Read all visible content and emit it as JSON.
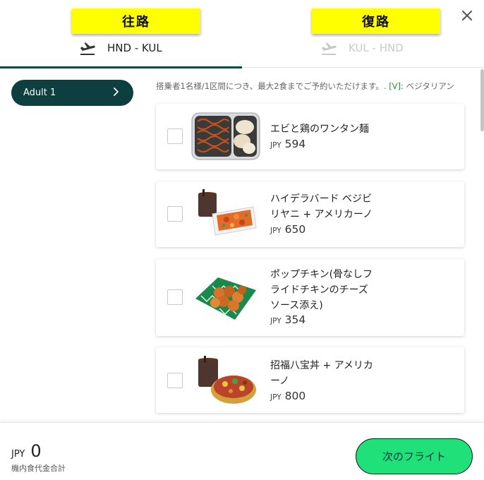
{
  "header": {
    "outbound_tab": {
      "highlight": "往路",
      "route": "HND - KUL"
    },
    "return_tab": {
      "highlight": "復路",
      "route": "KUL - HND"
    },
    "close_icon": "close-icon",
    "active_color": "#0c4a47"
  },
  "sidebar": {
    "passenger": "Adult 1",
    "icon": "chevron-right-icon"
  },
  "main": {
    "note_main": "搭乗者1名様/1区間につき、最大2食までご予約いただけます。. ",
    "note_veg_tag": "[V]",
    "note_veg_text": ": ベジタリアン",
    "meals": [
      {
        "name": "エビと鶏のワンタン麺",
        "currency": "JPY",
        "price": "594",
        "selected": false
      },
      {
        "name": "ハイデラバード ベジビリヤニ + アメリカーノ",
        "currency": "JPY",
        "price": "650",
        "selected": false
      },
      {
        "name": "ポップチキン(骨なしフライドチキンのチーズソース添え)",
        "currency": "JPY",
        "price": "354",
        "selected": false
      },
      {
        "name": "招福八宝丼 + アメリカーノ",
        "currency": "JPY",
        "price": "800",
        "selected": false
      }
    ]
  },
  "footer": {
    "currency": "JPY",
    "total": "0",
    "total_label": "機内食代金合計",
    "next_button": "次のフライト",
    "button_color": "#1fe079"
  }
}
